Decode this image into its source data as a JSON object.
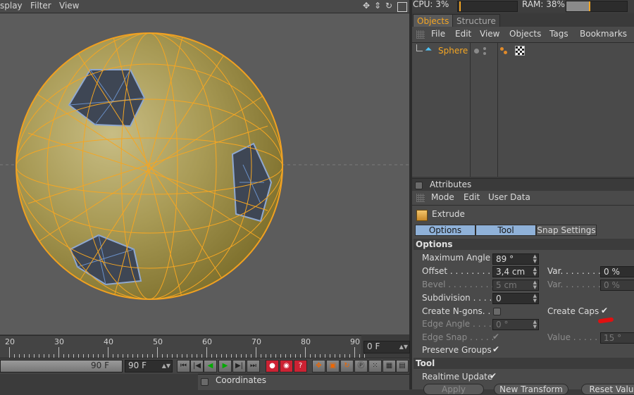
{
  "viewport_menu": {
    "display": "splay",
    "filter": "Filter",
    "view": "View"
  },
  "viewport_icons": [
    "move-icon",
    "scroll-icon",
    "rotate-icon",
    "maximize-icon"
  ],
  "timeline": {
    "ticks": [
      "20",
      "30",
      "40",
      "50",
      "60",
      "70",
      "80",
      "90"
    ],
    "current_frame": "0 F",
    "slider_value": "90 F",
    "end_frame": "90 F"
  },
  "coordinates_panel": {
    "title": "Coordinates"
  },
  "system": {
    "cpu": "CPU: 3%",
    "ram": "RAM: 38%"
  },
  "object_manager": {
    "tabs": [
      "Objects",
      "Structure"
    ],
    "menu": [
      "File",
      "Edit",
      "View",
      "Objects",
      "Tags",
      "Bookmarks"
    ],
    "object_name": "Sphere"
  },
  "attributes": {
    "title": "Attributes",
    "menu": [
      "Mode",
      "Edit",
      "User Data"
    ],
    "tool_name": "Extrude",
    "subtabs": [
      "Options",
      "Tool",
      "Snap Settings"
    ],
    "options_header": "Options",
    "max_angle_label": "Maximum Angle",
    "max_angle_value": "89 °",
    "offset_label": "Offset . . . . . . . . . .",
    "offset_value": "3,4 cm",
    "var1_label": "Var. . . . . . . . .",
    "var1_value": "0 %",
    "bevel_label": "Bevel . . . . . . . . . .",
    "bevel_value": "5 cm",
    "var2_label": "Var. . . . . . . . .",
    "var2_value": "0 %",
    "subdivision_label": "Subdivision . . . .",
    "subdivision_value": "0",
    "create_ngons_label": "Create N-gons. .",
    "create_caps_label": "Create Caps",
    "edge_angle_label": "Edge Angle . . . . .",
    "edge_angle_value": "0 °",
    "edge_snap_label": "Edge Snap . . . . .",
    "value_label": "Value . . . . .",
    "value_value": "15 °",
    "preserve_groups_label": "Preserve Groups",
    "tool_header": "Tool",
    "realtime_update_label": "Realtime Update",
    "apply_label": "Apply",
    "new_transform_label": "New Transform",
    "reset_values_label": "Reset Valu"
  },
  "colors": {
    "accent": "#f5a623",
    "selection": "#e8a020",
    "tab_active": "#8fb1d8"
  }
}
